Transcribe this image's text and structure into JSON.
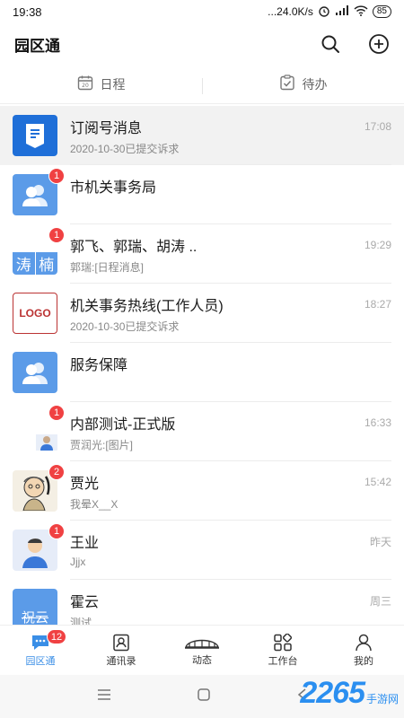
{
  "status_bar": {
    "time": "19:38",
    "network_speed": "...24.0K/s",
    "battery": "85"
  },
  "header": {
    "title": "园区通"
  },
  "quick_tabs": [
    {
      "label": "日程",
      "icon": "calendar-icon"
    },
    {
      "label": "待办",
      "icon": "clipboard-check-icon"
    }
  ],
  "chats": [
    {
      "name": "订阅号消息",
      "time": "17:08",
      "preview": "2020-10-30已提交诉求",
      "badge": "",
      "avatar": "subscription"
    },
    {
      "name": "市机关事务局",
      "time": "",
      "preview": "",
      "badge": "1",
      "avatar": "group"
    },
    {
      "name": "郭飞、郭瑞、胡涛 ..",
      "time": "19:29",
      "preview": "郭瑞:[日程消息]",
      "badge": "1",
      "avatar": "mosaic"
    },
    {
      "name": "机关事务热线(工作人员)",
      "time": "18:27",
      "preview": "2020-10-30已提交诉求",
      "badge": "",
      "avatar": "logo"
    },
    {
      "name": "服务保障",
      "time": "",
      "preview": "",
      "badge": "",
      "avatar": "group"
    },
    {
      "name": "内部测试-正式版",
      "time": "16:33",
      "preview": "贾润光:[图片]",
      "badge": "1",
      "avatar": "mosaic2"
    },
    {
      "name": "贾光",
      "time": "15:42",
      "preview": "我晕X__X",
      "badge": "2",
      "avatar": "cartoon"
    },
    {
      "name": "王业",
      "time": "昨天",
      "preview": "Jjjx",
      "badge": "1",
      "avatar": "person"
    },
    {
      "name": "霍云",
      "time": "周三",
      "preview": "测试",
      "badge": "",
      "avatar": "text"
    }
  ],
  "avatar_texts": {
    "logo": "LOGO",
    "mosaic_a": "涛",
    "mosaic_b": "楠",
    "text_avatar": "祝云"
  },
  "bottom_nav": [
    {
      "label": "园区通",
      "badge": "12",
      "active": true
    },
    {
      "label": "通讯录",
      "badge": ""
    },
    {
      "label": "动态",
      "badge": ""
    },
    {
      "label": "工作台",
      "badge": ""
    },
    {
      "label": "我的",
      "badge": ""
    }
  ],
  "watermark": {
    "number": "2265",
    "text": "手游网"
  },
  "colors": {
    "accent": "#3a8ee6",
    "badge": "#f04142",
    "avatar_blue": "#5b9be8"
  }
}
